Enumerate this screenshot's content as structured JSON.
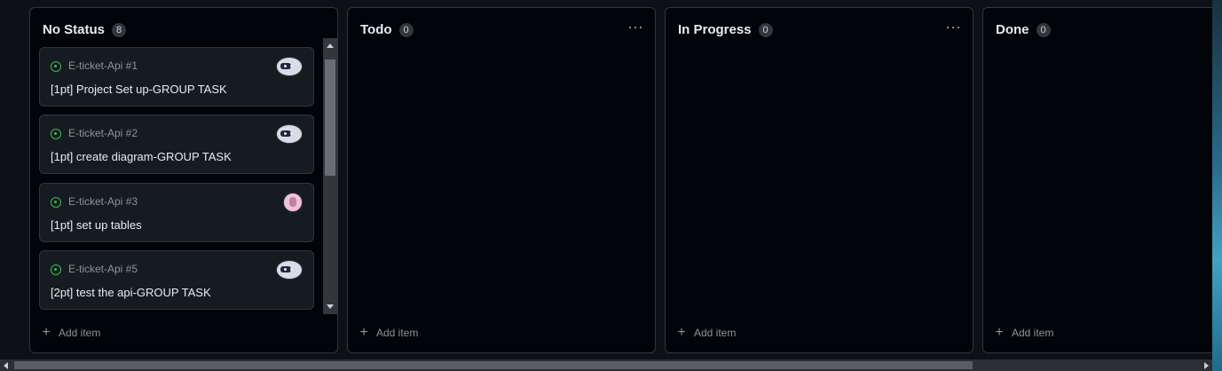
{
  "columns": [
    {
      "title": "No Status",
      "count": "8",
      "add_item_label": "Add item",
      "cards": [
        {
          "repo": "E-ticket-Api #1",
          "title": "[1pt] Project Set up-GROUP TASK"
        },
        {
          "repo": "E-ticket-Api #2",
          "title": "[1pt] create diagram-GROUP TASK"
        },
        {
          "repo": "E-ticket-Api #3",
          "title": "[1pt] set up tables"
        },
        {
          "repo": "E-ticket-Api #5",
          "title": "[2pt] test the api-GROUP TASK"
        }
      ]
    },
    {
      "title": "Todo",
      "count": "0",
      "add_item_label": "Add item",
      "cards": []
    },
    {
      "title": "In Progress",
      "count": "0",
      "add_item_label": "Add item",
      "cards": []
    },
    {
      "title": "Done",
      "count": "0",
      "add_item_label": "Add item",
      "cards": []
    }
  ],
  "icons": {
    "more": "more-options-icon",
    "issue": "issue-open-icon",
    "plus": "plus-icon"
  },
  "colors": {
    "background": "#0d1117",
    "column_bg": "#010409",
    "card_bg": "#161b22",
    "border": "#30363d",
    "issue_open": "#3fb950",
    "muted_text": "#8b949e"
  }
}
